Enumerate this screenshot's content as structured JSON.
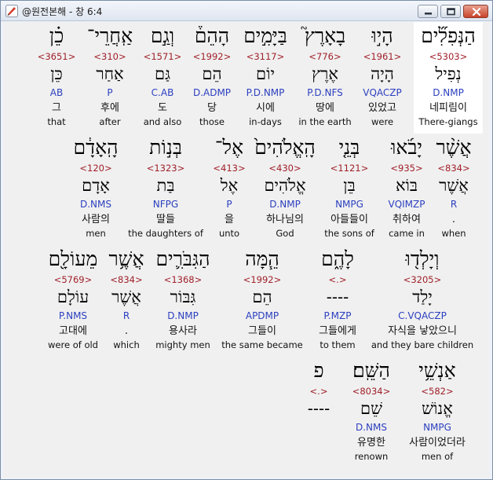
{
  "window": {
    "title": "@원전본해 - 창 6:4"
  },
  "rows": [
    {
      "words": [
        {
          "heb": "הַנְּפִלִ֞ים",
          "strong": "<5303>",
          "lemma": "נְפִיל",
          "morph": "D.NMP",
          "kor": "네피림이",
          "eng": "There-giangs"
        },
        {
          "heb": "הָי֣וּ",
          "strong": "<1961>",
          "lemma": "הָיָה",
          "morph": "VQACZP",
          "kor": "있었고",
          "eng": "were"
        },
        {
          "heb": "בָאָרֶץ֮",
          "strong": "<776>",
          "lemma": "אֶרֶץ",
          "morph": "P.D.NFS",
          "kor": "땅에",
          "eng": "in the earth"
        },
        {
          "heb": "בַּיָּמִ֣ים",
          "strong": "<3117>",
          "lemma": "יוֹם",
          "morph": "P.D.NMP",
          "kor": "시에",
          "eng": "in-days"
        },
        {
          "heb": "הָהֵם֒",
          "strong": "<1992>",
          "lemma": "הֵם",
          "morph": "D.ADMP",
          "kor": "당",
          "eng": "those"
        },
        {
          "heb": "וְגַ֣ם",
          "strong": "<1571>",
          "lemma": "גַּם",
          "morph": "C.AB",
          "kor": "도",
          "eng": "and also"
        },
        {
          "heb": "אַֽחֲרֵי־",
          "strong": "<310>",
          "lemma": "אַחַר",
          "morph": "P",
          "kor": "후에",
          "eng": "after"
        },
        {
          "heb": "כֵ֗ן",
          "strong": "<3651>",
          "lemma": "כֵּן",
          "morph": "AB",
          "kor": "그",
          "eng": "that"
        }
      ]
    },
    {
      "words": [
        {
          "heb": "אֲשֶׁ֨ר",
          "strong": "<834>",
          "lemma": "אֲשֶׁר",
          "morph": "R",
          "kor": ".",
          "eng": "when"
        },
        {
          "heb": "יָבֹ֜אוּ",
          "strong": "<935>",
          "lemma": "בּוֹא",
          "morph": "VQIMZP",
          "kor": "취하여",
          "eng": "came in"
        },
        {
          "heb": "בְּנֵ֤י",
          "strong": "<1121>",
          "lemma": "בֵּן",
          "morph": "NMPG",
          "kor": "아들들이",
          "eng": "the sons of"
        },
        {
          "heb": "הָֽאֱלֹהִים֙",
          "strong": "<430>",
          "lemma": "אֱלֹהִים",
          "morph": "D.NMP",
          "kor": "하나님의",
          "eng": "God"
        },
        {
          "heb": "אֶל־",
          "strong": "<413>",
          "lemma": "אֶל",
          "morph": "P",
          "kor": "을",
          "eng": "unto"
        },
        {
          "heb": "בְּנ֣וֹת",
          "strong": "<1323>",
          "lemma": "בַּת",
          "morph": "NFPG",
          "kor": "딸들",
          "eng": "the daughters of"
        },
        {
          "heb": "הָֽאָדָ֔ם",
          "strong": "<120>",
          "lemma": "אָדָם",
          "morph": "D.NMS",
          "kor": "사람의",
          "eng": "men"
        }
      ]
    },
    {
      "words": [
        {
          "heb": "וְיָלְד֖וּ",
          "strong": "<3205>",
          "lemma": "יָלַד",
          "morph": "C.VQACZP",
          "kor": "자식을 낳았으니",
          "eng": "and they bare children"
        },
        {
          "heb": "לָהֶ֑ם",
          "strong": "<.>",
          "lemma": "----",
          "morph": "P.MZP",
          "kor": "그들에게",
          "eng": "to them"
        },
        {
          "heb": "הֵ֧מָּה",
          "strong": "<1992>",
          "lemma": "הֵם",
          "morph": "APDMP",
          "kor": "그들이",
          "eng": "the same became"
        },
        {
          "heb": "הַגִּבֹּרִ֛ים",
          "strong": "<1368>",
          "lemma": "גִּבּוֹר",
          "morph": "D.NMP",
          "kor": "용사라",
          "eng": "mighty men"
        },
        {
          "heb": "אֲשֶׁ֥ר",
          "strong": "<834>",
          "lemma": "אֲשֶׁר",
          "morph": "R",
          "kor": ".",
          "eng": "which"
        },
        {
          "heb": "מֵעוֹלָ֖ם",
          "strong": "<5769>",
          "lemma": "עוֹלָם",
          "morph": "P.NMS",
          "kor": "고대에",
          "eng": "were of old"
        }
      ]
    },
    {
      "words": [
        {
          "heb": "אַנְשֵׁ֥י",
          "strong": "<582>",
          "lemma": "אֱנוֹשׁ",
          "morph": "NMPG",
          "kor": "사람이었더라",
          "eng": "men of"
        },
        {
          "heb": "הַשֵּֽׁם׃",
          "strong": "<8034>",
          "lemma": "שֵׁם",
          "morph": "D.NMS",
          "kor": "유명한",
          "eng": "renown"
        },
        {
          "heb": "פ",
          "strong": "<.>",
          "lemma": "----",
          "morph": "",
          "kor": "",
          "eng": ""
        }
      ]
    }
  ]
}
